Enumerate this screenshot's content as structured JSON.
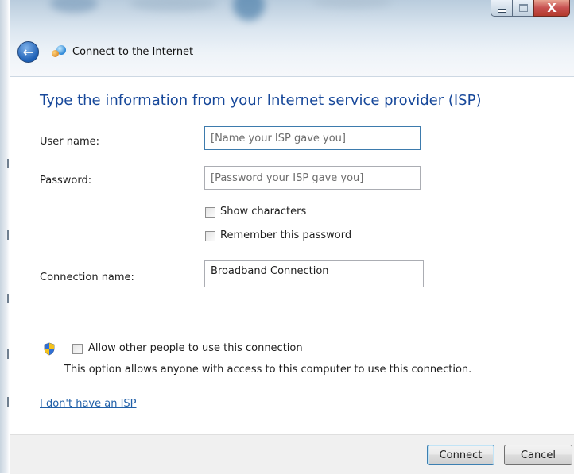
{
  "window": {
    "title": "Connect to the Internet",
    "close_glyph": "X"
  },
  "form": {
    "instruction": "Type the information from your Internet service provider (ISP)",
    "user_name": {
      "label": "User name:",
      "value": "",
      "placeholder": "[Name your ISP gave you]"
    },
    "password": {
      "label": "Password:",
      "value": "",
      "placeholder": "[Password your ISP gave you]"
    },
    "show_characters": {
      "label": "Show characters",
      "checked": false
    },
    "remember_password": {
      "label": "Remember this password",
      "checked": false
    },
    "connection_name": {
      "label": "Connection name:",
      "value": "Broadband Connection"
    },
    "allow_others": {
      "label": "Allow other people to use this connection",
      "checked": false,
      "description": "This option allows anyone with access to this computer to use this connection."
    },
    "no_isp_link": "I don't have an ISP"
  },
  "footer": {
    "connect_label": "Connect",
    "cancel_label": "Cancel"
  },
  "icons": {
    "back": "back-arrow-icon",
    "title": "network-globe-icon",
    "uac": "uac-shield-icon"
  },
  "colors": {
    "instruction_text": "#17489a",
    "link": "#1f5fa8",
    "close_button": "#c75050",
    "footer_bg": "#f0f0f0"
  }
}
